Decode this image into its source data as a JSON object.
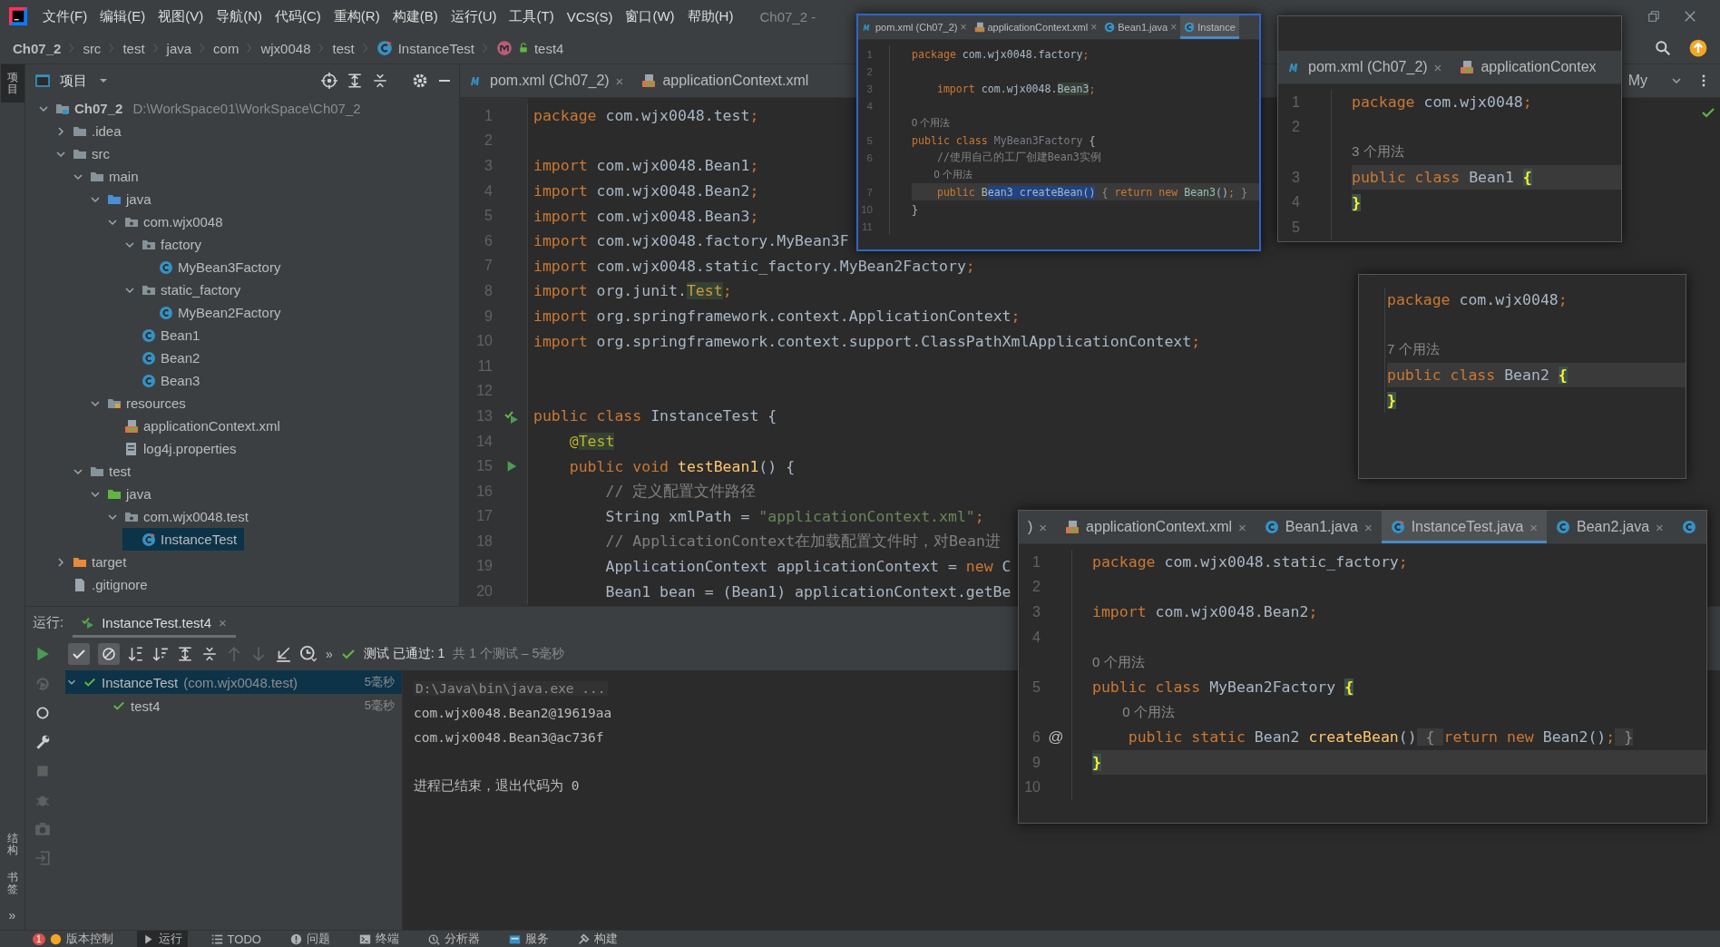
{
  "menubar": {
    "items": [
      "文件(F)",
      "编辑(E)",
      "视图(V)",
      "导航(N)",
      "代码(C)",
      "重构(R)",
      "构建(B)",
      "运行(U)",
      "工具(T)",
      "VCS(S)",
      "窗口(W)",
      "帮助(H)"
    ],
    "title": "Ch07_2 -"
  },
  "breadcrumb": [
    {
      "label": "Ch07_2",
      "kind": "project"
    },
    {
      "label": "src",
      "kind": "dir"
    },
    {
      "label": "test",
      "kind": "dir"
    },
    {
      "label": "java",
      "kind": "dir"
    },
    {
      "label": "com",
      "kind": "dir"
    },
    {
      "label": "wjx0048",
      "kind": "dir"
    },
    {
      "label": "test",
      "kind": "dir"
    },
    {
      "label": "InstanceTest",
      "kind": "class"
    },
    {
      "label": "test4",
      "kind": "method"
    }
  ],
  "side_strip": {
    "top": [
      {
        "label": "项目",
        "selected": true
      }
    ],
    "bottom": [
      {
        "label": "结构",
        "selected": false
      },
      {
        "label": "书签",
        "selected": false
      }
    ],
    "more": "»"
  },
  "project": {
    "title": "项目",
    "tree": [
      {
        "label": "Ch07_2",
        "kind": "module",
        "path": "D:\\WorkSpace01\\WorkSpace\\Ch07_2",
        "expanded": true,
        "selected": false,
        "children": [
          {
            "label": ".idea",
            "kind": "folder",
            "expanded": false,
            "selected": false
          },
          {
            "label": "src",
            "kind": "folder",
            "expanded": true,
            "selected": false,
            "children": [
              {
                "label": "main",
                "kind": "folder",
                "expanded": true,
                "selected": false,
                "children": [
                  {
                    "label": "java",
                    "kind": "source",
                    "expanded": true,
                    "selected": false,
                    "children": [
                      {
                        "label": "com.wjx0048",
                        "kind": "package",
                        "expanded": true,
                        "selected": false,
                        "children": [
                          {
                            "label": "factory",
                            "kind": "package",
                            "expanded": true,
                            "selected": false,
                            "children": [
                              {
                                "label": "MyBean3Factory",
                                "kind": "class",
                                "selected": false
                              }
                            ]
                          },
                          {
                            "label": "static_factory",
                            "kind": "package",
                            "expanded": true,
                            "selected": false,
                            "children": [
                              {
                                "label": "MyBean2Factory",
                                "kind": "class",
                                "selected": false
                              }
                            ]
                          },
                          {
                            "label": "Bean1",
                            "kind": "class",
                            "selected": false
                          },
                          {
                            "label": "Bean2",
                            "kind": "class",
                            "selected": false
                          },
                          {
                            "label": "Bean3",
                            "kind": "class",
                            "selected": false
                          }
                        ]
                      }
                    ]
                  },
                  {
                    "label": "resources",
                    "kind": "resources",
                    "expanded": true,
                    "selected": false,
                    "children": [
                      {
                        "label": "applicationContext.xml",
                        "kind": "xml",
                        "selected": false
                      },
                      {
                        "label": "log4j.properties",
                        "kind": "properties",
                        "selected": false
                      }
                    ]
                  }
                ]
              },
              {
                "label": "test",
                "kind": "folder",
                "expanded": true,
                "selected": false,
                "children": [
                  {
                    "label": "java",
                    "kind": "testsource",
                    "expanded": true,
                    "selected": false,
                    "children": [
                      {
                        "label": "com.wjx0048.test",
                        "kind": "package",
                        "expanded": true,
                        "selected": false,
                        "children": [
                          {
                            "label": "InstanceTest",
                            "kind": "testclass",
                            "selected": true
                          }
                        ]
                      }
                    ]
                  }
                ]
              }
            ]
          },
          {
            "label": "target",
            "kind": "excluded",
            "expanded": false,
            "selected": false
          },
          {
            "label": ".gitignore",
            "kind": "file",
            "selected": false
          }
        ]
      }
    ]
  },
  "editor": {
    "tabs": [
      {
        "label": "pom.xml (Ch07_2)",
        "kind": "maven",
        "close": "×",
        "selected": false
      },
      {
        "label": "applicationContext.xml",
        "kind": "xml",
        "selected": false
      }
    ],
    "side_tab": "My",
    "lines": [
      {
        "n": "1",
        "kind": "top",
        "current": false,
        "tokens": [
          {
            "kind": "keyword",
            "text": "package "
          },
          {
            "kind": "ident",
            "text": "com.wjx0048.test"
          },
          {
            "kind": "keyword",
            "text": ";"
          }
        ]
      },
      {
        "n": "2",
        "kind": "top",
        "current": false
      },
      {
        "n": "3",
        "kind": "top",
        "current": false,
        "tokens": [
          {
            "kind": "keyword",
            "text": "import "
          },
          {
            "kind": "ident",
            "text": "com.wjx0048.Bean1"
          },
          {
            "kind": "keyword",
            "text": ";"
          }
        ]
      },
      {
        "n": "4",
        "kind": "top",
        "current": false,
        "tokens": [
          {
            "kind": "keyword",
            "text": "import "
          },
          {
            "kind": "ident",
            "text": "com.wjx0048.Bean2"
          },
          {
            "kind": "keyword",
            "text": ";"
          }
        ]
      },
      {
        "n": "5",
        "kind": "top",
        "current": false,
        "tokens": [
          {
            "kind": "keyword",
            "text": "import "
          },
          {
            "kind": "ident",
            "text": "com.wjx0048.Bean3"
          },
          {
            "kind": "keyword",
            "text": ";"
          }
        ]
      },
      {
        "n": "6",
        "kind": "top",
        "current": false,
        "tokens": [
          {
            "kind": "keyword",
            "text": "import "
          },
          {
            "kind": "ident",
            "text": "com.wjx0048.factory.MyBean3F"
          }
        ]
      },
      {
        "n": "7",
        "kind": "top",
        "current": false,
        "tokens": [
          {
            "kind": "keyword",
            "text": "import "
          },
          {
            "kind": "ident",
            "text": "com.wjx0048.static_factory.MyBean2Factory"
          },
          {
            "kind": "keyword",
            "text": ";"
          }
        ]
      },
      {
        "n": "8",
        "kind": "top",
        "current": false,
        "tokens": [
          {
            "kind": "keyword",
            "text": "import "
          },
          {
            "kind": "ident",
            "text": "org.junit."
          },
          {
            "kind": "test-ref",
            "text": "Test"
          },
          {
            "kind": "keyword",
            "text": ";"
          }
        ]
      },
      {
        "n": "9",
        "kind": "top",
        "current": false,
        "tokens": [
          {
            "kind": "keyword",
            "text": "import "
          },
          {
            "kind": "ident",
            "text": "org.springframework.context.ApplicationContext"
          },
          {
            "kind": "keyword",
            "text": ";"
          }
        ]
      },
      {
        "n": "10",
        "kind": "top",
        "current": false,
        "tokens": [
          {
            "kind": "keyword",
            "text": "import "
          },
          {
            "kind": "ident",
            "text": "org.springframework.context.support.ClassPathXmlApplicationContext"
          },
          {
            "kind": "keyword",
            "text": ";"
          }
        ]
      },
      {
        "n": "11",
        "kind": "top",
        "current": false
      },
      {
        "n": "12",
        "kind": "top",
        "current": false
      },
      {
        "n": "13",
        "kind": "top",
        "current": false,
        "gutter": {
          "kind": "run-class"
        },
        "tokens": [
          {
            "kind": "keyword",
            "text": "public class "
          },
          {
            "kind": "ident",
            "text": "InstanceTest {"
          }
        ]
      },
      {
        "n": "14",
        "kind": "member",
        "current": false,
        "tokens": [
          {
            "kind": "annotation",
            "text": "@"
          },
          {
            "kind": "annotation-ref",
            "text": "Test"
          }
        ]
      },
      {
        "n": "15",
        "kind": "member",
        "current": false,
        "gutter": {
          "kind": "run"
        },
        "tokens": [
          {
            "kind": "keyword",
            "text": "public void "
          },
          {
            "kind": "method",
            "text": "testBean1"
          },
          {
            "kind": "ident",
            "text": "() {"
          }
        ]
      },
      {
        "n": "16",
        "kind": "body",
        "current": false,
        "tokens": [
          {
            "kind": "comment",
            "text": "// 定义配置文件路径"
          }
        ]
      },
      {
        "n": "17",
        "kind": "body",
        "current": false,
        "tokens": [
          {
            "kind": "ident",
            "text": "String xmlPath = "
          },
          {
            "kind": "string",
            "text": "\"applicationContext.xml\""
          },
          {
            "kind": "keyword",
            "text": ";"
          }
        ]
      },
      {
        "n": "18",
        "kind": "body",
        "current": false,
        "tokens": [
          {
            "kind": "comment",
            "text": "// ApplicationContext在加载配置文件时，对Bean进"
          }
        ]
      },
      {
        "n": "19",
        "kind": "body",
        "current": false,
        "tokens": [
          {
            "kind": "ident",
            "text": "ApplicationContext applicationContext = "
          },
          {
            "kind": "keyword",
            "text": "new "
          },
          {
            "kind": "ident",
            "text": "C"
          }
        ]
      },
      {
        "n": "20",
        "kind": "body",
        "current": false,
        "tokens": [
          {
            "kind": "ident",
            "text": "Bean1 bean = (Bean1) applicationContext.getBe"
          }
        ]
      }
    ]
  },
  "popups": [
    {
      "kind": "small",
      "tabs": [
        {
          "label": "pom.xml (Ch07_2)",
          "kind": "maven",
          "close": "×",
          "selected": false
        },
        {
          "label": "applicationContext.xml",
          "kind": "xml",
          "close": "×",
          "selected": false
        },
        {
          "label": "Bean1.java",
          "kind": "class",
          "close": "×",
          "selected": false
        },
        {
          "label": "Instance",
          "kind": "testclass",
          "selected": true
        }
      ],
      "lines": [
        {
          "n": "1",
          "kind": "top",
          "current": false,
          "tokens": [
            {
              "kind": "keyword",
              "text": "package "
            },
            {
              "kind": "ident",
              "text": "com.wjx0048.factory"
            },
            {
              "kind": "keyword",
              "text": ";"
            }
          ]
        },
        {
          "n": "2",
          "kind": "top",
          "current": false
        },
        {
          "n": "3",
          "kind": "member",
          "current": false,
          "tokens": [
            {
              "kind": "keyword",
              "text": "import "
            },
            {
              "kind": "ident",
              "text": "com.wjx0048."
            },
            {
              "kind": "reference",
              "text": "Bean3"
            },
            {
              "kind": "keyword",
              "text": ";"
            }
          ]
        },
        {
          "n": "4",
          "kind": "top",
          "current": false
        },
        {
          "kind": "hint",
          "text": "0 个用法"
        },
        {
          "n": "5",
          "kind": "top",
          "current": false,
          "tokens": [
            {
              "kind": "keyword",
              "text": "public class "
            },
            {
              "kind": "unused",
              "text": "MyBean3Factory"
            },
            {
              "kind": "ident",
              "text": " {"
            }
          ]
        },
        {
          "n": "6",
          "kind": "member",
          "current": false,
          "tokens": [
            {
              "kind": "comment",
              "text": "//使用自己的工厂创建Bean3实例"
            }
          ]
        },
        {
          "kind": "hint-member",
          "text": "0 个用法"
        },
        {
          "n": "7",
          "kind": "member",
          "current": true,
          "tokens": [
            {
              "kind": "keyword",
              "text": "public "
            },
            {
              "kind": "ident",
              "text": "B"
            },
            {
              "kind": "selection",
              "text": "ean3 createBean()"
            },
            {
              "kind": "folded",
              "text": " { "
            },
            {
              "kind": "keyword",
              "text": "return new "
            },
            {
              "kind": "reference",
              "text": "Bean3"
            },
            {
              "kind": "ident",
              "text": "()"
            },
            {
              "kind": "keyword",
              "text": ";"
            },
            {
              "kind": "folded",
              "text": " }"
            }
          ]
        },
        {
          "n": "10",
          "kind": "top",
          "current": false,
          "tokens": [
            {
              "kind": "ident",
              "text": "}"
            }
          ]
        },
        {
          "n": "11",
          "kind": "top",
          "current": false
        }
      ]
    },
    {
      "kind": "large",
      "tabs": [
        {
          "label": "pom.xml (Ch07_2)",
          "kind": "maven",
          "close": "×",
          "selected": false
        },
        {
          "label": "applicationContex",
          "kind": "xml",
          "selected": false
        }
      ],
      "lines": [
        {
          "n": "1",
          "kind": "top",
          "current": false,
          "tokens": [
            {
              "kind": "keyword",
              "text": "package "
            },
            {
              "kind": "ident",
              "text": "com.wjx0048"
            },
            {
              "kind": "keyword",
              "text": ";"
            }
          ]
        },
        {
          "n": "2",
          "kind": "top",
          "current": false
        },
        {
          "kind": "hint",
          "text": "3 个用法"
        },
        {
          "n": "3",
          "kind": "top",
          "current": true,
          "tokens": [
            {
              "kind": "keyword",
              "text": "public class "
            },
            {
              "kind": "ident",
              "text": "Bean1 "
            },
            {
              "kind": "brace",
              "text": "{"
            }
          ]
        },
        {
          "n": "4",
          "kind": "top",
          "current": false,
          "tokens": [
            {
              "kind": "brace",
              "text": "}"
            }
          ]
        },
        {
          "n": "5",
          "kind": "top",
          "current": false
        }
      ]
    },
    {
      "kind": "bare",
      "lines": [
        {
          "kind": "top",
          "current": false,
          "tokens": [
            {
              "kind": "keyword",
              "text": "package "
            },
            {
              "kind": "ident",
              "text": "com.wjx0048"
            },
            {
              "kind": "keyword",
              "text": ";"
            }
          ]
        },
        {
          "kind": "top",
          "current": false
        },
        {
          "kind": "hint",
          "text": "7 个用法"
        },
        {
          "kind": "top",
          "current": true,
          "tokens": [
            {
              "kind": "keyword",
              "text": "public class "
            },
            {
              "kind": "ident",
              "text": "Bean2 "
            },
            {
              "kind": "brace",
              "text": "{"
            }
          ]
        },
        {
          "kind": "top",
          "current": false,
          "tokens": [
            {
              "kind": "brace",
              "text": "}"
            }
          ]
        }
      ]
    },
    {
      "kind": "large",
      "tabs": [
        {
          "label": ")",
          "close": "×",
          "selected": false
        },
        {
          "label": "applicationContext.xml",
          "kind": "xml",
          "close": "×",
          "selected": false
        },
        {
          "label": "Bean1.java",
          "kind": "class",
          "close": "×",
          "selected": false
        },
        {
          "label": "InstanceTest.java",
          "kind": "testclass",
          "close": "×",
          "selected": true
        },
        {
          "label": "Bean2.java",
          "kind": "class",
          "close": "×",
          "selected": false
        },
        {
          "kind": "class",
          "selected": false
        }
      ],
      "lines": [
        {
          "n": "1",
          "kind": "top",
          "current": false,
          "tokens": [
            {
              "kind": "keyword",
              "text": "package "
            },
            {
              "kind": "ident",
              "text": "com.wjx0048.static_factory"
            },
            {
              "kind": "keyword",
              "text": ";"
            }
          ]
        },
        {
          "n": "2",
          "kind": "top",
          "current": false
        },
        {
          "n": "3",
          "kind": "top",
          "current": false,
          "tokens": [
            {
              "kind": "keyword",
              "text": "import "
            },
            {
              "kind": "ident",
              "text": "com.wjx0048.Bean2"
            },
            {
              "kind": "keyword",
              "text": ";"
            }
          ]
        },
        {
          "n": "4",
          "kind": "top",
          "current": false
        },
        {
          "kind": "hint",
          "text": "0 个用法"
        },
        {
          "n": "5",
          "kind": "top",
          "current": false,
          "tokens": [
            {
              "kind": "keyword",
              "text": "public class "
            },
            {
              "kind": "ident",
              "text": "MyBean2Factory "
            },
            {
              "kind": "brace",
              "text": "{"
            }
          ]
        },
        {
          "kind": "hint-member",
          "text": "0 个用法"
        },
        {
          "n": "6",
          "kind": "member",
          "current": false,
          "mark": "@",
          "tokens": [
            {
              "kind": "keyword",
              "text": "public static "
            },
            {
              "kind": "ident",
              "text": "Bean2 "
            },
            {
              "kind": "method",
              "text": "createBean"
            },
            {
              "kind": "ident",
              "text": "()"
            },
            {
              "kind": "folded",
              "text": " { "
            },
            {
              "kind": "keyword",
              "text": "return new "
            },
            {
              "kind": "ident",
              "text": "Bean2()"
            },
            {
              "kind": "keyword",
              "text": ";"
            },
            {
              "kind": "folded",
              "text": " }"
            }
          ]
        },
        {
          "n": "9",
          "kind": "top",
          "current": true,
          "tokens": [
            {
              "kind": "brace",
              "text": "}"
            }
          ]
        },
        {
          "n": "10",
          "kind": "top",
          "current": false
        }
      ]
    }
  ],
  "run": {
    "label": "运行:",
    "tab": {
      "label": "InstanceTest.test4",
      "close": "×",
      "selected": true
    },
    "filters": [
      {
        "kind": "passed",
        "on": true
      },
      {
        "kind": "ignored",
        "on": true
      }
    ],
    "more": "»",
    "status": "测试 已通过: 1",
    "status_detail": "共 1 个测试 – 5毫秒",
    "tests": [
      {
        "label": "InstanceTest",
        "detail": "(com.wjx0048.test)",
        "time": "5毫秒",
        "passed": true,
        "selected": true,
        "expanded": true,
        "children": [
          {
            "label": "test4",
            "time": "5毫秒",
            "passed": true,
            "selected": false
          }
        ]
      }
    ],
    "console": [
      {
        "kind": "command",
        "text": "D:\\Java\\bin\\java.exe ..."
      },
      {
        "kind": "out",
        "text": "com.wjx0048.Bean2@19619aa"
      },
      {
        "kind": "out",
        "text": "com.wjx0048.Bean3@ac736f"
      },
      {
        "kind": "blank"
      },
      {
        "kind": "out",
        "text": "进程已结束，退出代码为 0"
      }
    ]
  },
  "toolbar_bottom": [
    {
      "label": "版本控制",
      "kind": "vcs",
      "badge": "1",
      "selected": false
    },
    {
      "label": "运行",
      "kind": "run",
      "selected": true
    },
    {
      "label": "TODO",
      "kind": "list",
      "selected": false
    },
    {
      "label": "问题",
      "kind": "problem",
      "selected": false
    },
    {
      "label": "终端",
      "kind": "terminal",
      "selected": false
    },
    {
      "label": "分析器",
      "kind": "profiler",
      "selected": false
    },
    {
      "label": "服务",
      "kind": "services",
      "selected": false
    },
    {
      "label": "构建",
      "kind": "build",
      "selected": false
    }
  ]
}
